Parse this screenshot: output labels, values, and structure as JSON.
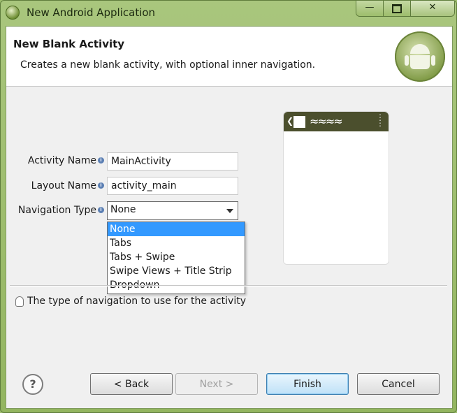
{
  "window": {
    "title": "New Android Application"
  },
  "header": {
    "title": "New Blank Activity",
    "description": "Creates a new blank activity, with optional inner navigation."
  },
  "form": {
    "activity_name": {
      "label": "Activity Name",
      "value": "MainActivity"
    },
    "layout_name": {
      "label": "Layout Name",
      "value": "activity_main"
    },
    "navigation_type": {
      "label": "Navigation Type",
      "value": "None",
      "options": [
        "None",
        "Tabs",
        "Tabs + Swipe",
        "Swipe Views + Title Strip",
        "Dropdown"
      ],
      "highlighted": "None"
    }
  },
  "hint": "The type of navigation to use for the activity",
  "buttons": {
    "back": "< Back",
    "next": "Next >",
    "finish": "Finish",
    "cancel": "Cancel"
  },
  "icons": {
    "app": "android-icon",
    "help": "help-icon",
    "hint": "lightbulb-icon",
    "info": "info-icon"
  },
  "colors": {
    "window_frame": "#9fbf6f",
    "selection": "#3399ff",
    "preview_bar": "#4b4f2d"
  }
}
